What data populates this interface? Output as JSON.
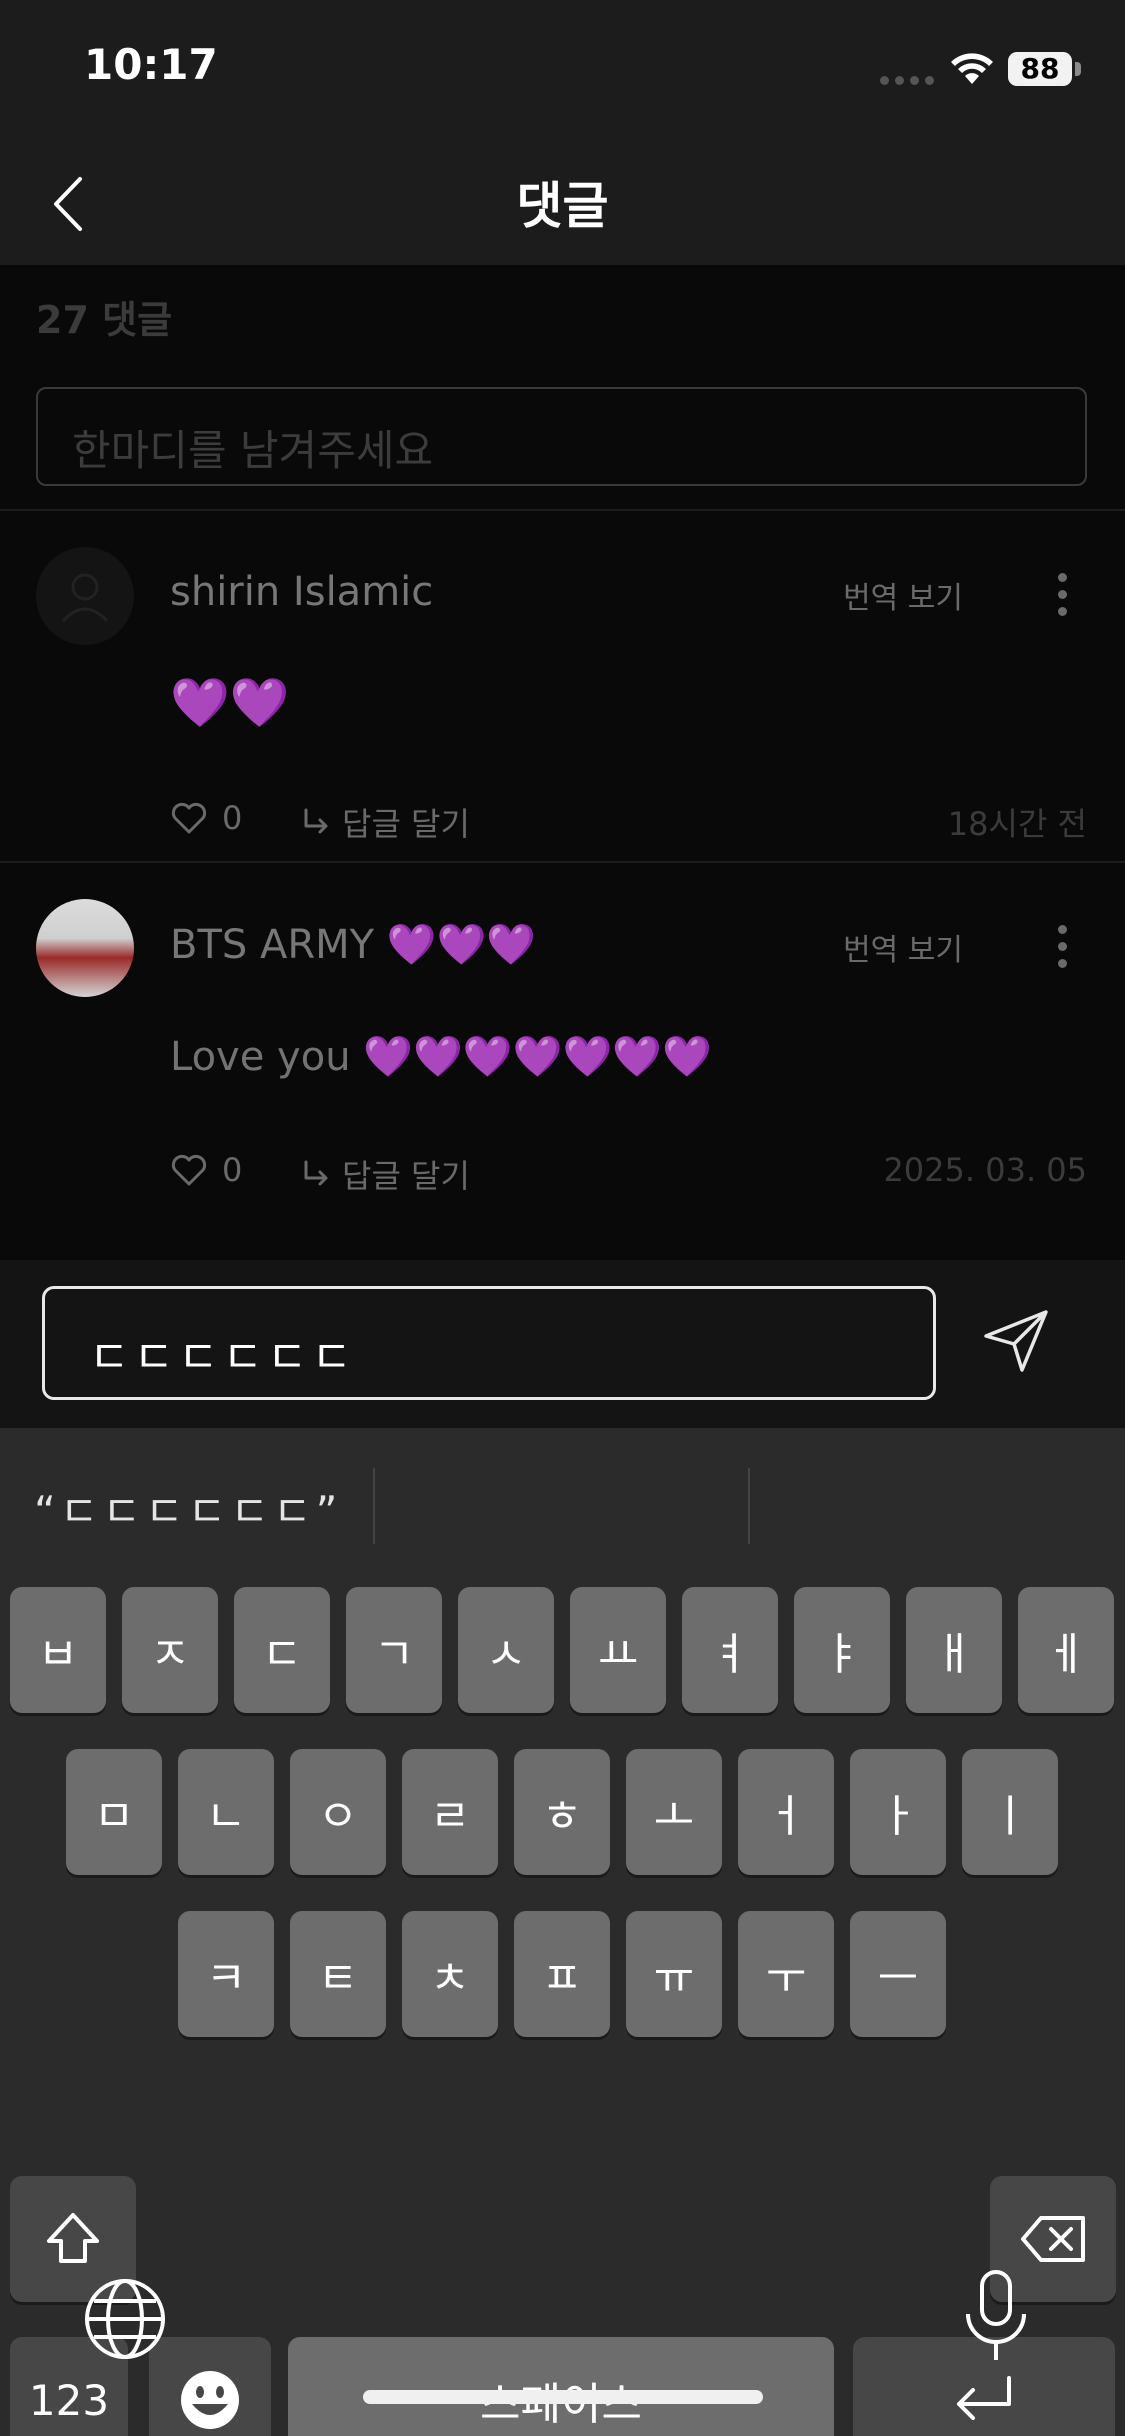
{
  "status_bar": {
    "time": "10:17",
    "battery": "88"
  },
  "header": {
    "title": "댓글"
  },
  "comments_section": {
    "count_label": "27 댓글",
    "input_placeholder": "한마디를 남겨주세요"
  },
  "comments": [
    {
      "username": "shirin Islamic",
      "translate_label": "번역 보기",
      "text": "💜💜",
      "likes": "0",
      "reply_label": "답글 달기",
      "time": "18시간 전"
    },
    {
      "username": "BTS ARMY 💜💜💜",
      "translate_label": "번역 보기",
      "text": "Love you 💜💜💜💜💜💜💜",
      "likes": "0",
      "reply_label": "답글 달기",
      "time": "2025. 03. 05"
    }
  ],
  "reply_input": {
    "value": "ㄷㄷㄷㄷㄷㄷ"
  },
  "keyboard": {
    "suggestion": "“ㄷㄷㄷㄷㄷㄷ”",
    "row1": [
      "ㅂ",
      "ㅈ",
      "ㄷ",
      "ㄱ",
      "ㅅ",
      "ㅛ",
      "ㅕ",
      "ㅑ",
      "ㅐ",
      "ㅔ"
    ],
    "row2": [
      "ㅁ",
      "ㄴ",
      "ㅇ",
      "ㄹ",
      "ㅎ",
      "ㅗ",
      "ㅓ",
      "ㅏ",
      "ㅣ"
    ],
    "row3": [
      "ㅋ",
      "ㅌ",
      "ㅊ",
      "ㅍ",
      "ㅠ",
      "ㅜ",
      "ㅡ"
    ],
    "numbers_label": "123",
    "space_label": "스페이스"
  }
}
